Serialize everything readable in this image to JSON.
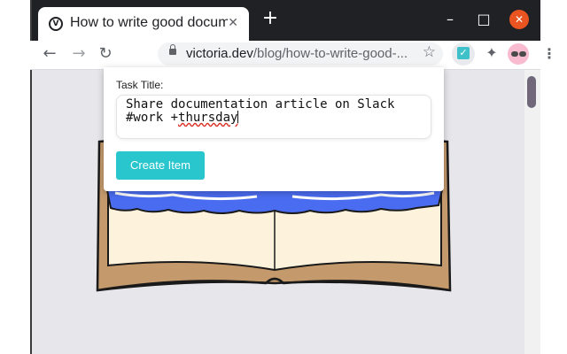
{
  "tab": {
    "title": "How to write good documentation",
    "favicon_letter": "V",
    "close_icon": "close-icon"
  },
  "window_controls": {
    "minimize": "–",
    "maximize": "□",
    "close": "✕"
  },
  "toolbar": {
    "back_icon": "back-arrow-icon",
    "forward_icon": "forward-arrow-icon",
    "reload_icon": "reload-icon",
    "url_domain": "victoria.dev",
    "url_path": "/blog/how-to-write-good-...",
    "bookmark_icon": "star-icon"
  },
  "popup": {
    "label": "Task Title:",
    "line1": "Share documentation article on Slack",
    "line2_plain": "#work +",
    "line2_misspelled": "thursday",
    "button_label": "Create Item"
  },
  "colors": {
    "accent": "#29c6cd",
    "titlebar": "#202124",
    "close": "#e95420",
    "book_blue": "#4a6cf0"
  }
}
